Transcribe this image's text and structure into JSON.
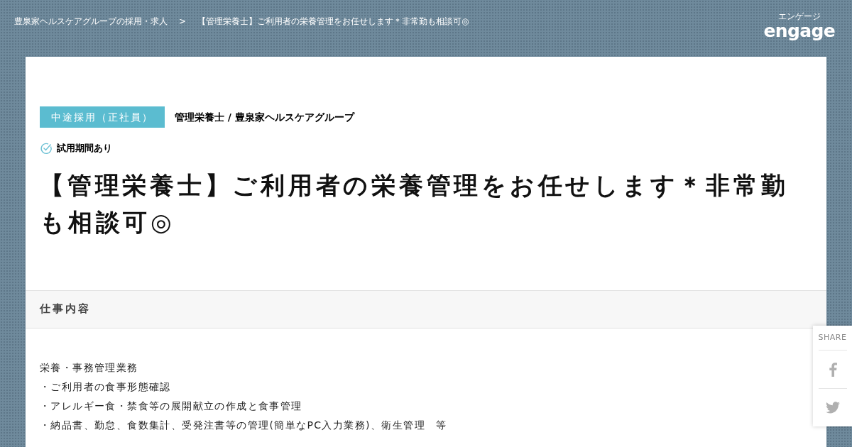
{
  "breadcrumb": {
    "items": [
      "豊泉家ヘルスケアグループの採用・求人",
      "【管理栄養士】ご利用者の栄養管理をお任せします＊非常勤も相談可◎"
    ],
    "separator": ">"
  },
  "logo": {
    "kana": "エンゲージ",
    "text": "engage"
  },
  "job": {
    "employment_tag": "中途採用（正社員）",
    "company": "管理栄養士 / 豊泉家ヘルスケアグループ",
    "trial": "試用期間あり",
    "title": "【管理栄養士】ご利用者の栄養管理をお任せします＊非常勤も相談可◎"
  },
  "section": {
    "heading": "仕事内容",
    "lines": [
      "栄養・事務管理業務",
      "・ご利用者の食事形態確認",
      "・アレルギー食・禁食等の展開献立の作成と食事管理",
      "・納品書、勤怠、食数集計、受発注書等の管理(簡単なPC入力業務)、衛生管理　等"
    ]
  },
  "share": {
    "label": "SHARE",
    "buttons": [
      {
        "kind": "facebook"
      },
      {
        "kind": "twitter"
      }
    ]
  }
}
